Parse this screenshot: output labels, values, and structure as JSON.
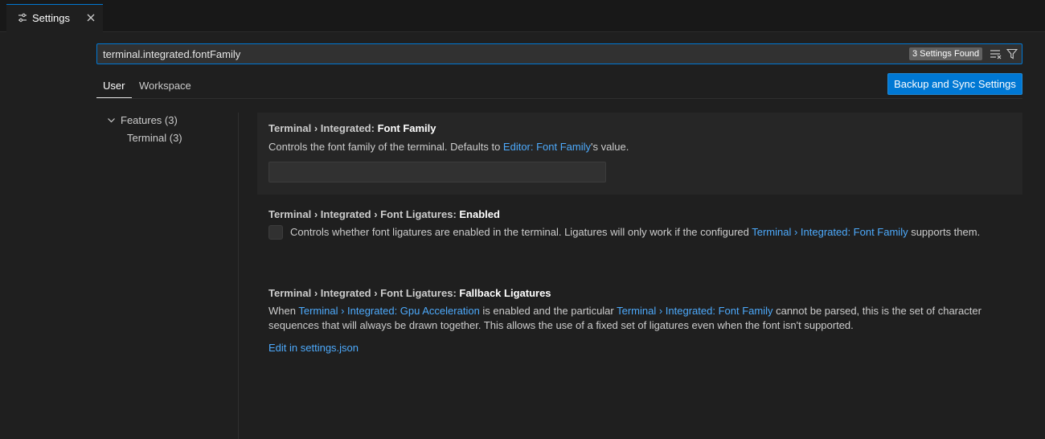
{
  "editor": {
    "tab_label": "Settings",
    "tab_icon": "settings-sliders-icon",
    "close_icon": "close-icon"
  },
  "search": {
    "value": "terminal.integrated.fontFamily",
    "result_count": "3 Settings Found",
    "clear_icon": "clear-filter-icon",
    "filter_icon": "filter-icon"
  },
  "scopes": {
    "user": "User",
    "workspace": "Workspace",
    "selected": "User"
  },
  "sync_button": "Backup and Sync Settings",
  "toc": {
    "features": "Features (3)",
    "terminal": "Terminal (3)",
    "expanded": true
  },
  "settings": [
    {
      "prefix": "Terminal › Integrated: ",
      "name": "Font Family",
      "desc_before": "Controls the font family of the terminal. Defaults to ",
      "link": "Editor: Font Family",
      "desc_after": "'s value.",
      "input_value": ""
    },
    {
      "prefix": "Terminal › Integrated › Font Ligatures: ",
      "name": "Enabled",
      "desc_before": "Controls whether font ligatures are enabled in the terminal. Ligatures will only work if the configured ",
      "link": "Terminal › Integrated: Font Family",
      "desc_after": " supports them.",
      "checked": false
    },
    {
      "prefix": "Terminal › Integrated › Font Ligatures: ",
      "name": "Fallback Ligatures",
      "desc_1": "When ",
      "link_1": "Terminal › Integrated: Gpu Acceleration",
      "desc_2": " is enabled and the particular ",
      "link_2": "Terminal › Integrated: Font Family",
      "desc_3": " cannot be parsed, this is the set of character sequences that will always be drawn together. This allows the use of a fixed set of ligatures even when the font isn't supported.",
      "edit_link": "Edit in settings.json"
    }
  ],
  "colors": {
    "accent": "#0078d4",
    "link": "#4daafc",
    "background": "#1f1f1f"
  }
}
